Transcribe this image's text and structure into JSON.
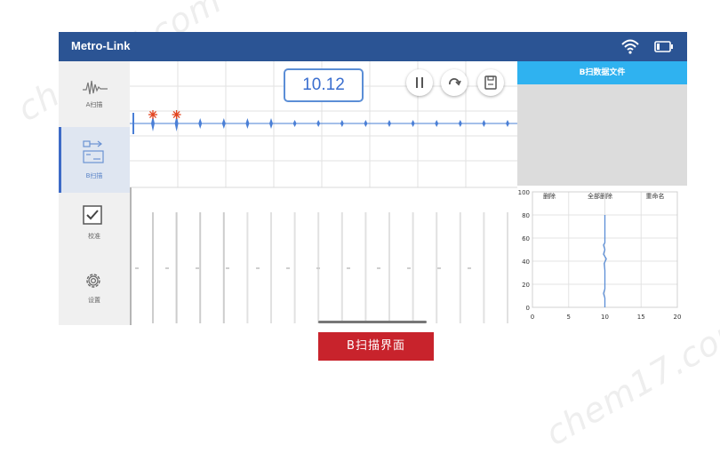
{
  "watermark": "chem17.com",
  "app": {
    "title": "Metro-Link"
  },
  "status": {
    "wifi_icon": "wifi-icon",
    "battery_icon": "battery-icon"
  },
  "sidebar": {
    "items": [
      {
        "label": "A扫描",
        "icon": "waveform-icon",
        "active": false
      },
      {
        "label": "B扫描",
        "icon": "bscan-icon",
        "active": true
      },
      {
        "label": "校准",
        "icon": "checkbox-icon",
        "active": false
      },
      {
        "label": "设置",
        "icon": "gear-icon",
        "active": false
      }
    ]
  },
  "scan": {
    "value": "10.12",
    "controls": [
      {
        "name": "pause",
        "icon": "pause-icon"
      },
      {
        "name": "refresh",
        "icon": "refresh-icon"
      },
      {
        "name": "save",
        "icon": "save-icon"
      }
    ],
    "pulse_count": 16,
    "marker_count": 2,
    "marker_color": "#e2441f",
    "trace_color": "#4a7fd6"
  },
  "file_panel": {
    "title": "B扫数据文件",
    "actions": [
      "删除",
      "全部删除",
      "重命名"
    ]
  },
  "chart_data": {
    "type": "line",
    "xlim": [
      0,
      20
    ],
    "ylim": [
      0,
      100
    ],
    "xticks": [
      "0",
      "5",
      "10",
      "15",
      "20"
    ],
    "yticks": [
      "0",
      "20",
      "40",
      "60",
      "80",
      "100"
    ],
    "grid": true,
    "series": [
      {
        "x": [
          10,
          10,
          9.8,
          10,
          10,
          9.9,
          10.2,
          9.8,
          10,
          9.8,
          10,
          10
        ],
        "y": [
          0,
          8,
          12,
          16,
          32,
          38,
          42,
          46,
          50,
          54,
          56,
          80
        ]
      }
    ],
    "color": "#5b8ed6"
  },
  "caption": "B扫描界面"
}
